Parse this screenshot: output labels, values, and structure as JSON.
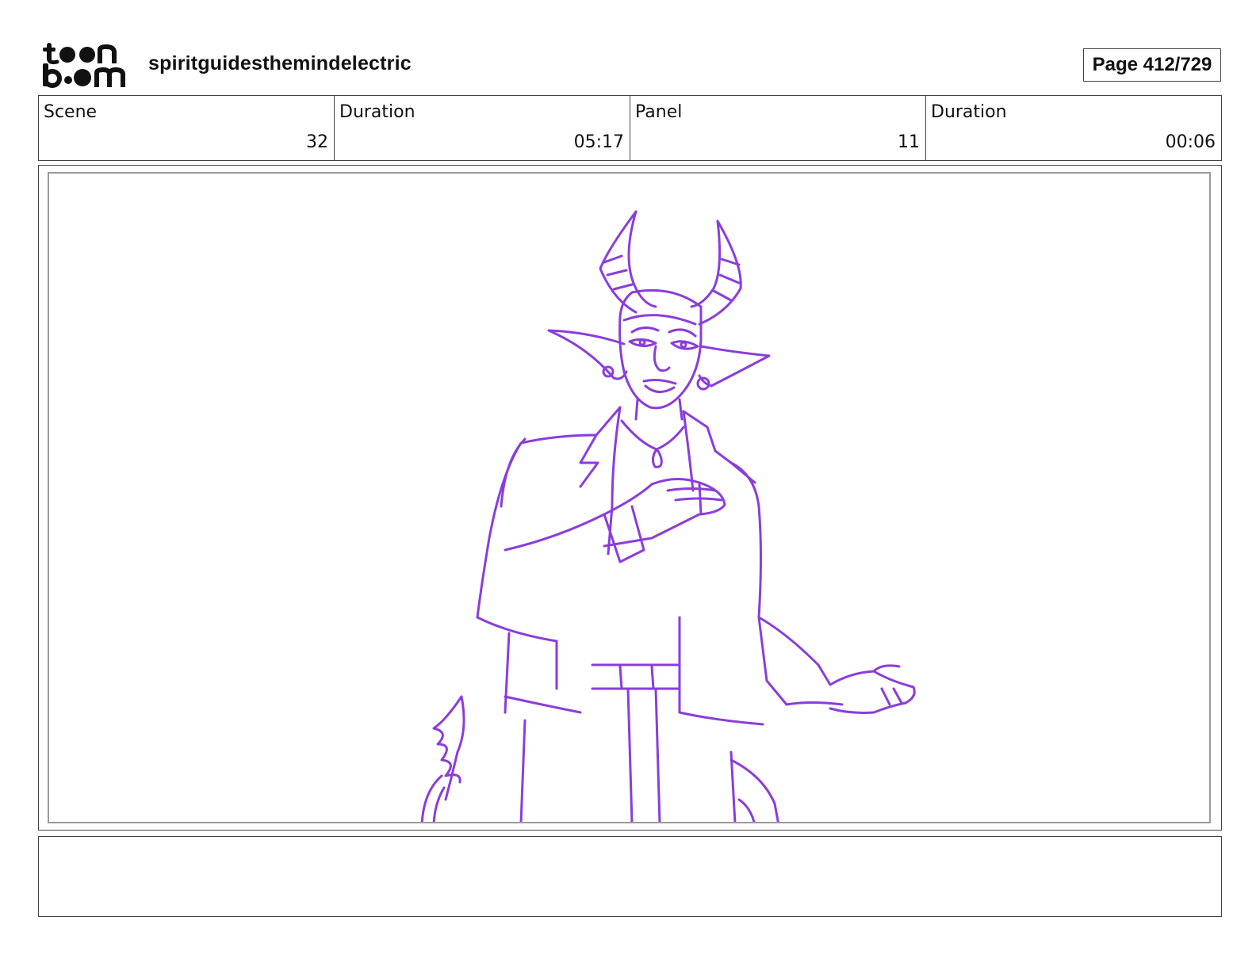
{
  "header": {
    "logo_text": [
      "toon",
      "boom"
    ],
    "project_title": "spiritguidesthemindelectric",
    "page_label": "Page 412/729"
  },
  "info": {
    "scene_label": "Scene",
    "scene_value": "32",
    "scene_duration_label": "Duration",
    "scene_duration_value": "05:17",
    "panel_label": "Panel",
    "panel_value": "11",
    "panel_duration_label": "Duration",
    "panel_duration_value": "00:06"
  },
  "panel": {
    "sketch_subject": "horned-character-sketch",
    "line_color": "#8a3ddb"
  },
  "notes": {
    "text": ""
  }
}
